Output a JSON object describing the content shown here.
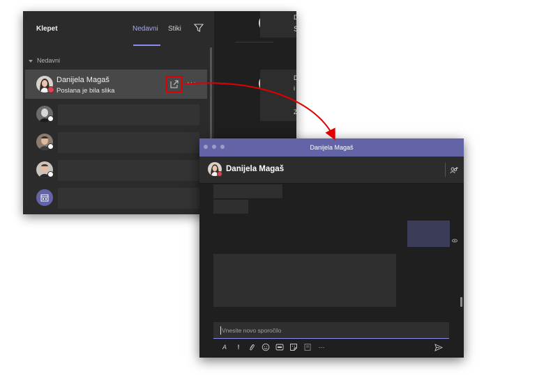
{
  "chat_list": {
    "title": "Klepet",
    "tabs": [
      {
        "label": "Nedavni",
        "active": true
      },
      {
        "label": "Stiki",
        "active": false
      }
    ],
    "filter_icon": "filter-icon",
    "section_label": "Nedavni",
    "active_item": {
      "name": "Danijela Magaš",
      "preview": "Poslana je bila slika",
      "status": "busy",
      "popout_icon": "pop-out-icon",
      "more_label": "···"
    }
  },
  "right_strip": {
    "letters": [
      "D",
      "S",
      "D",
      "i",
      "Z"
    ]
  },
  "popout_window": {
    "title": "Danijela Magaš",
    "header_name": "Danijela Magaš",
    "compose_placeholder": "Vnesite novo sporočilo",
    "toolbar_icons": [
      "format-icon",
      "important-icon",
      "attach-icon",
      "emoji-icon",
      "gif-icon",
      "sticker-icon",
      "praise-icon",
      "more-icon"
    ],
    "toolbar_glyphs": {
      "format": "A",
      "important": "!",
      "more": "···"
    },
    "send_icon": "send-icon"
  },
  "colors": {
    "accent": "#6264a7",
    "highlight_box": "#e10000",
    "arrow": "#e10000",
    "status_busy": "#e43f4d"
  }
}
